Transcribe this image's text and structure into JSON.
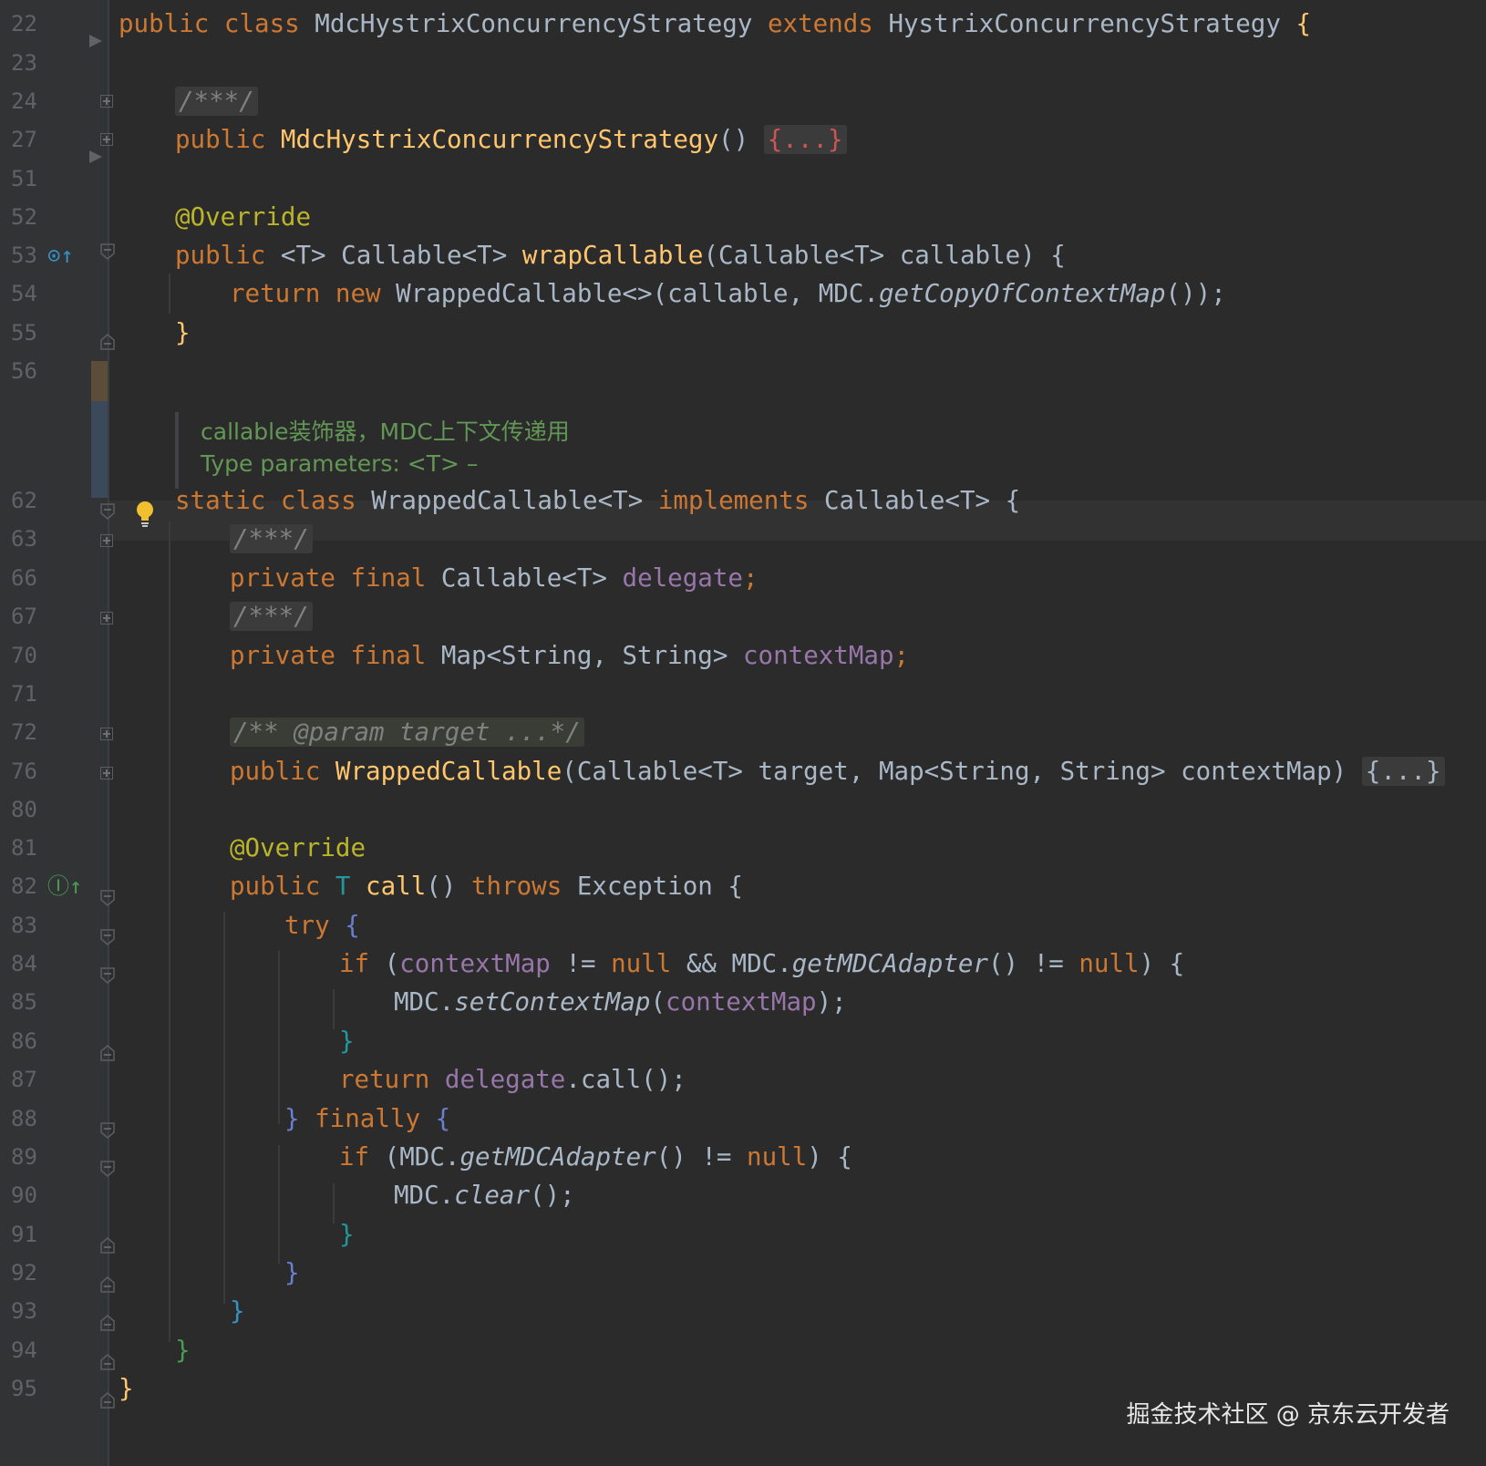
{
  "lines": [
    {
      "num": "22"
    },
    {
      "num": "23"
    },
    {
      "num": "24"
    },
    {
      "num": "27"
    },
    {
      "num": "51"
    },
    {
      "num": "52"
    },
    {
      "num": "53"
    },
    {
      "num": "54"
    },
    {
      "num": "55"
    },
    {
      "num": "56"
    },
    {
      "num": "62"
    },
    {
      "num": "63"
    },
    {
      "num": "66"
    },
    {
      "num": "67"
    },
    {
      "num": "70"
    },
    {
      "num": "71"
    },
    {
      "num": "72"
    },
    {
      "num": "76"
    },
    {
      "num": "80"
    },
    {
      "num": "81"
    },
    {
      "num": "82"
    },
    {
      "num": "83"
    },
    {
      "num": "84"
    },
    {
      "num": "85"
    },
    {
      "num": "86"
    },
    {
      "num": "87"
    },
    {
      "num": "88"
    },
    {
      "num": "89"
    },
    {
      "num": "90"
    },
    {
      "num": "91"
    },
    {
      "num": "92"
    },
    {
      "num": "93"
    },
    {
      "num": "94"
    },
    {
      "num": "95"
    }
  ],
  "code": {
    "l22_public": "public",
    "l22_class": "class",
    "l22_name": "MdcHystrixConcurrencyStrategy",
    "l22_extends": "extends",
    "l22_super": "HystrixConcurrencyStrategy",
    "l22_brace": "{",
    "l24_doc": "/***/",
    "l27_public": "public",
    "l27_ctor": "MdcHystrixConcurrencyStrategy",
    "l27_parens": "()",
    "l27_folded": "{...}",
    "l52_ann": "@Override",
    "l53_public": "public",
    "l53_rest": "<T> Callable<T> ",
    "l53_fn": "wrapCallable",
    "l53_params": "(Callable<T> callable) {",
    "l54_return": "return",
    "l54_new": "new",
    "l54_rest": "WrappedCallable<>(callable, MDC.",
    "l54_method": "getCopyOfContextMap",
    "l54_end": "());",
    "l55_brace": "}",
    "doc_line1": "callable装饰器，MDC上下文传递用",
    "doc_line2": "Type parameters: <T> –",
    "l62_static": "static",
    "l62_class": "class",
    "l62_name": "WrappedCallable<T>",
    "l62_impl": "implements",
    "l62_iface": "Callable<T> {",
    "l63_doc": "/***/",
    "l66_private": "private",
    "l66_final": "final",
    "l66_type": "Callable<T>",
    "l66_field": "delegate",
    "l66_semi": ";",
    "l67_doc": "/***/",
    "l70_private": "private",
    "l70_final": "final",
    "l70_type": "Map<String, String>",
    "l70_field": "contextMap",
    "l70_semi": ";",
    "l72_doc": "/** @param target ...*/",
    "l76_public": "public",
    "l76_ctor": "WrappedCallable",
    "l76_params": "(Callable<T> target, Map<String, String> contextMap)",
    "l76_folded": "{...}",
    "l81_ann": "@Override",
    "l82_public": "public",
    "l82_T": "T",
    "l82_fn": "call",
    "l82_parens": "()",
    "l82_throws": "throws",
    "l82_exc": "Exception {",
    "l83_try": "try",
    "l83_brace": "{",
    "l84_if": "if",
    "l84_open": " (",
    "l84_field": "contextMap",
    "l84_neq": " != ",
    "l84_null": "null",
    "l84_and": " && MDC.",
    "l84_method": "getMDCAdapter",
    "l84_mid": "() != ",
    "l84_null2": "null",
    "l84_end": ") {",
    "l85_mdc": "MDC.",
    "l85_method": "setContextMap",
    "l85_open": "(",
    "l85_field": "contextMap",
    "l85_end": ");",
    "l86_brace": "}",
    "l87_return": "return",
    "l87_field": "delegate",
    "l87_rest": ".call();",
    "l88_brace": "}",
    "l88_finally": "finally",
    "l88_open": "{",
    "l89_if": "if",
    "l89_open": " (MDC.",
    "l89_method": "getMDCAdapter",
    "l89_mid": "() != ",
    "l89_null": "null",
    "l89_end": ") {",
    "l90_mdc": "MDC.",
    "l90_method": "clear",
    "l90_end": "();",
    "l91_brace": "}",
    "l92_brace": "}",
    "l93_brace": "}",
    "l94_brace": "}",
    "l95_brace": "}"
  },
  "watermark": "掘金技术社区 @ 京东云开发者",
  "colors": {
    "background": "#2b2b2b",
    "gutter": "#313335",
    "keyword": "#cc7832",
    "function": "#ffc66d",
    "annotation": "#bbb529",
    "field": "#9876aa",
    "type_param": "#20999d",
    "doc_comment": "#629755",
    "plain": "#a9b7c6"
  },
  "icons": [
    "fold-plus-icon",
    "fold-down-icon",
    "fold-up-icon",
    "override-icon",
    "implements-icon",
    "lightbulb-icon"
  ]
}
